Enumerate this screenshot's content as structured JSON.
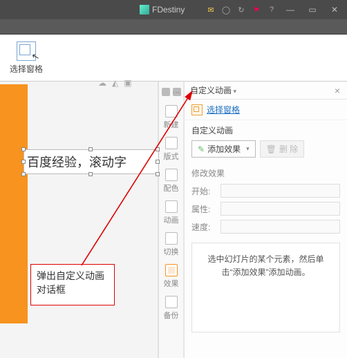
{
  "titlebar": {
    "app_name": "FDestiny"
  },
  "toolbar": {
    "select_panes_label": "选择窗格"
  },
  "canvas": {
    "textbox_text": "百度经验，滚动字"
  },
  "callout": {
    "text": "弹出自定义动画对话框"
  },
  "side": {
    "items": [
      {
        "label": "新建"
      },
      {
        "label": "版式"
      },
      {
        "label": "配色"
      },
      {
        "label": "动画"
      },
      {
        "label": "切换"
      },
      {
        "label": "效果"
      },
      {
        "label": "备份"
      }
    ]
  },
  "panel": {
    "title": "自定义动画",
    "select_panes_link": "选择窗格",
    "sub_title": "自定义动画",
    "add_effect_btn": "添加效果",
    "delete_btn": "删 除",
    "modify_title": "修改效果",
    "labels": {
      "start": "开始:",
      "property": "属性:",
      "speed": "速度:"
    },
    "hint": "选中幻灯片的某个元素，然后单击“添加效果”添加动画。"
  }
}
